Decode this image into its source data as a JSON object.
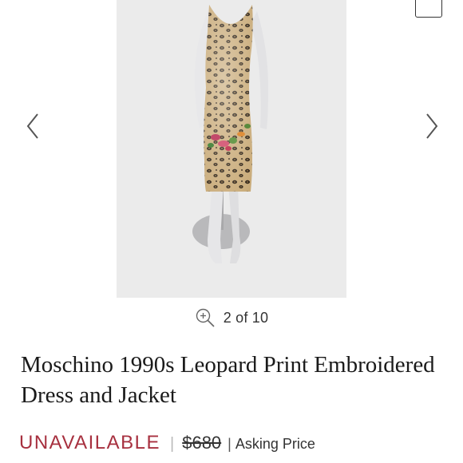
{
  "gallery": {
    "image_subject": "mannequin-leopard-dress-photo",
    "counter_text": "2 of 10"
  },
  "product": {
    "title": "Moschino 1990s Leopard Print Embroidered Dress and Jacket"
  },
  "pricing": {
    "status": "UNAVAILABLE",
    "separator": "|",
    "price": "$680",
    "price_separator": "|",
    "price_label": "Asking Price"
  },
  "colors": {
    "status_red": "#a7303f",
    "text_dark": "#1a1a1a",
    "photo_bg": "#ebebeb"
  },
  "icons": {
    "prev": "chevron-left-icon",
    "next": "chevron-right-icon",
    "zoom": "zoom-in-icon",
    "expand": "expand-icon"
  }
}
